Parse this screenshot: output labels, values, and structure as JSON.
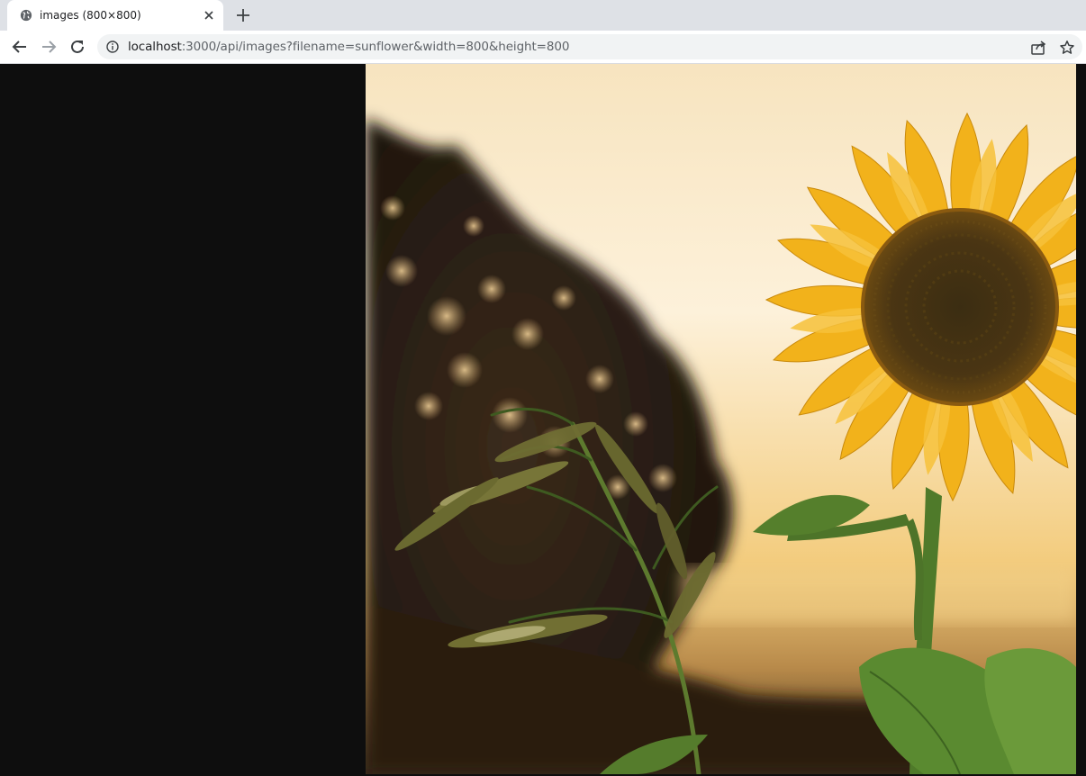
{
  "tab": {
    "title": "images (800×800)",
    "favicon": "globe-icon",
    "close_icon": "close-icon"
  },
  "toolbar": {
    "back_icon": "back-arrow-icon",
    "forward_icon": "forward-arrow-icon",
    "reload_icon": "reload-icon",
    "info_icon": "info-icon",
    "share_icon": "share-icon",
    "bookmark_icon": "star-icon"
  },
  "address_bar": {
    "host": "localhost",
    "rest": ":3000/api/images?filename=sunflower&width=800&height=800"
  },
  "image": {
    "subject": "sunflower",
    "natural_size": "800×800"
  },
  "colors": {
    "tabstrip": "#dee1e6",
    "toolbar": "#ffffff",
    "omnibox": "#f1f3f4",
    "viewport_bg": "#0e0e0e",
    "petal": "#f2b21b",
    "sky": "#fbe9c4"
  }
}
